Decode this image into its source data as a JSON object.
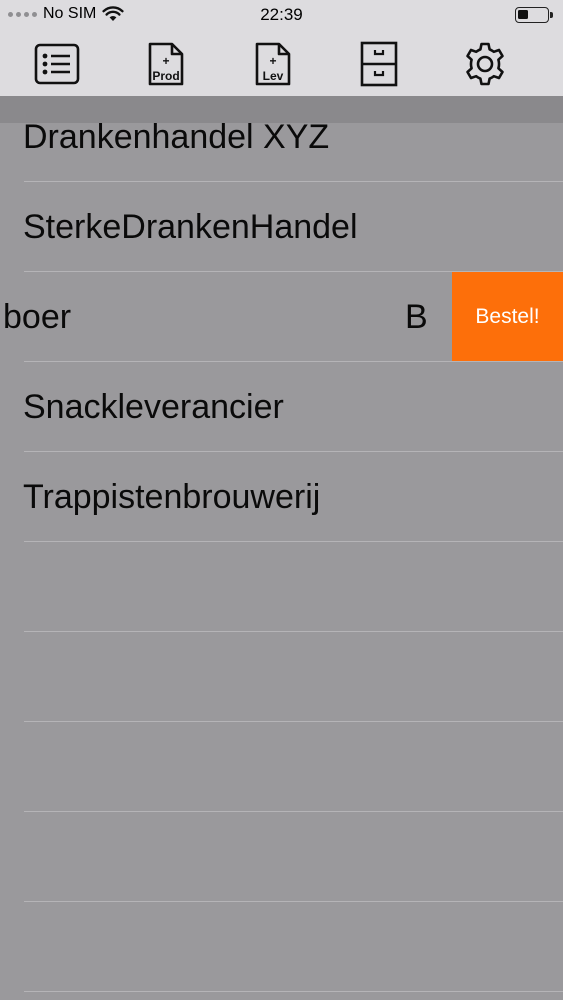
{
  "status_bar": {
    "carrier": "No SIM",
    "time": "22:39",
    "signal_icon": "signal-dots-icon",
    "wifi_icon": "wifi-icon",
    "battery_icon": "battery-icon",
    "battery_level": 0.35
  },
  "toolbar": {
    "items": [
      {
        "name": "list-icon"
      },
      {
        "name": "add-product-icon",
        "plus": "+",
        "label": "Prod"
      },
      {
        "name": "add-supplier-icon",
        "plus": "+",
        "label": "Lev"
      },
      {
        "name": "archive-cabinet-icon"
      },
      {
        "name": "settings-gear-icon"
      }
    ]
  },
  "list": {
    "rows": [
      {
        "label": "Drankenhandel XYZ"
      },
      {
        "label": "SterkeDrankenHandel"
      },
      {
        "label": "boer",
        "trailing": "B",
        "action": "Bestel!"
      },
      {
        "label": "Snackleverancier"
      },
      {
        "label": "Trappistenbrouwerij"
      },
      {
        "label": ""
      },
      {
        "label": ""
      },
      {
        "label": ""
      },
      {
        "label": ""
      },
      {
        "label": ""
      }
    ]
  },
  "colors": {
    "background": "#9a999c",
    "toolbar": "#dddcdf",
    "action": "#fd6f0a"
  }
}
